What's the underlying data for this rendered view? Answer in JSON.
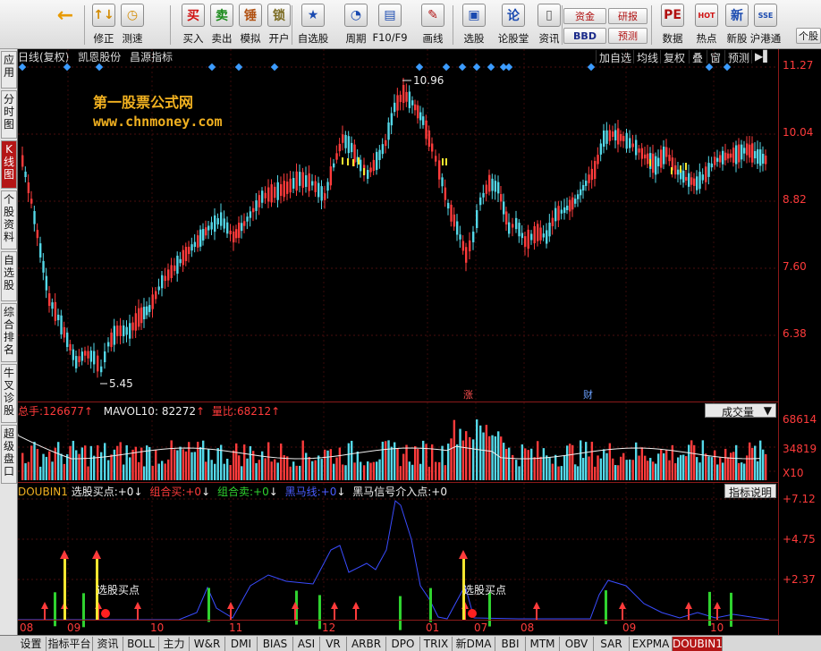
{
  "toolbar": {
    "buttons": [
      {
        "label": "修正",
        "icon": "↑↓"
      },
      {
        "label": "测速",
        "icon": "◷"
      },
      {
        "label": "买入",
        "icon": "买"
      },
      {
        "label": "卖出",
        "icon": "卖"
      },
      {
        "label": "模拟",
        "icon": "锤"
      },
      {
        "label": "开户",
        "icon": "锁"
      },
      {
        "label": "自选股",
        "icon": "★"
      },
      {
        "label": "周期",
        "icon": "◔"
      },
      {
        "label": "F10/F9",
        "icon": "▤"
      },
      {
        "label": "画线",
        "icon": "✎"
      },
      {
        "label": "选股",
        "icon": "▣"
      },
      {
        "label": "论股堂",
        "icon": "论"
      },
      {
        "label": "资讯",
        "icon": "▯"
      },
      {
        "label": "数据",
        "icon": "PE"
      },
      {
        "label": "热点",
        "icon": "HOT"
      },
      {
        "label": "新股",
        "icon": "新"
      },
      {
        "label": "沪港通",
        "icon": "SSE"
      }
    ],
    "small_buttons": {
      "zijin": "资金",
      "bbd": "BBD",
      "yanbao": "研报",
      "yuce": "预测",
      "geren": "个股"
    },
    "back_arrow": "←"
  },
  "left_tabs": [
    "应用",
    "分时图",
    "K线图",
    "个股资料",
    "自选股",
    "综合排名",
    "牛叉诊股",
    "超级盘口"
  ],
  "chart_header": {
    "period": "日线(复权)",
    "stock_name": "凯恩股份",
    "indicator_name": "昌源指标",
    "buttons": [
      "加自选",
      "均线",
      "复权",
      "叠",
      "窗",
      "预测"
    ]
  },
  "watermark": {
    "line1": "第一股票公式网",
    "line2": "www.chnmoney.com"
  },
  "price_axis": [
    "11.27",
    "10.04",
    "8.82",
    "7.60",
    "6.38"
  ],
  "price_annotations": {
    "high": "10.96",
    "low": "5.45",
    "marker_zhang": "涨",
    "marker_cai": "财"
  },
  "volume": {
    "total_label": "总手:",
    "total_value": "126677",
    "mavol_label": "MAVOL10:",
    "mavol_value": "82272",
    "ratio_label": "量比:",
    "ratio_value": "68212",
    "axis": [
      "68614",
      "34819",
      "X10"
    ],
    "combo": "成交量"
  },
  "indicator": {
    "name": "DOUBIN1",
    "items": [
      {
        "label": "选股买点:",
        "value": "+0"
      },
      {
        "label": "组合买:",
        "value": "+0"
      },
      {
        "label": "组合卖:",
        "value": "+0"
      },
      {
        "label": "黑马线:",
        "value": "+0"
      },
      {
        "label": "黑马信号介入点:",
        "value": "+0"
      }
    ],
    "axis": [
      "+7.12",
      "+4.75",
      "+2.37"
    ],
    "button": "指标说明",
    "annotation": "选股买点"
  },
  "x_axis": [
    "08",
    "09",
    "10",
    "11",
    "12",
    "01",
    "07",
    "08",
    "09",
    "10"
  ],
  "bottom_tabs": [
    "设置",
    "指标平台",
    "资讯",
    "BOLL",
    "主力",
    "W&R",
    "DMI",
    "BIAS",
    "ASI",
    "VR",
    "ARBR",
    "DPO",
    "TRIX",
    "新DMA",
    "BBI",
    "MTM",
    "OBV",
    "SAR",
    "EXPMA",
    "DOUBIN1"
  ],
  "colors": {
    "up": "#ff3b3b",
    "down": "#54d8e8",
    "panel_border": "#8b1a1a",
    "accent": "#b41616",
    "yellow": "#f0b020"
  }
}
